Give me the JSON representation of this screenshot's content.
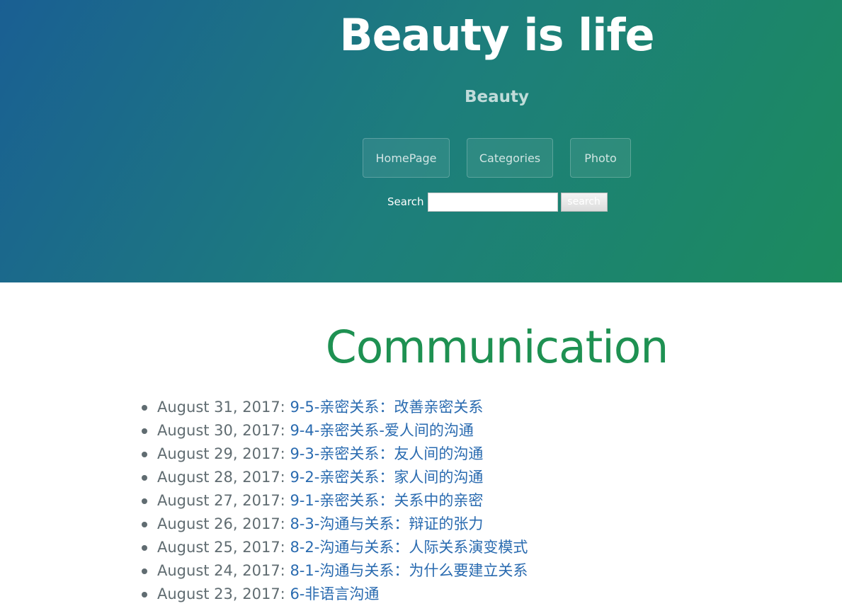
{
  "header": {
    "title": "Beauty is life",
    "tagline": "Beauty",
    "nav": [
      {
        "label": "HomePage"
      },
      {
        "label": "Categories"
      },
      {
        "label": "Photo"
      }
    ],
    "search": {
      "label": "Search",
      "value": "",
      "button_label": "search"
    }
  },
  "main": {
    "title": "Communication",
    "posts": [
      {
        "date": "August 31, 2017:",
        "title": "9-5-亲密关系：改善亲密关系"
      },
      {
        "date": "August 30, 2017:",
        "title": "9-4-亲密关系-爱人间的沟通"
      },
      {
        "date": "August 29, 2017:",
        "title": "9-3-亲密关系：友人间的沟通"
      },
      {
        "date": "August 28, 2017:",
        "title": "9-2-亲密关系：家人间的沟通"
      },
      {
        "date": "August 27, 2017:",
        "title": "9-1-亲密关系：关系中的亲密"
      },
      {
        "date": "August 26, 2017:",
        "title": "8-3-沟通与关系：辩证的张力"
      },
      {
        "date": "August 25, 2017:",
        "title": "8-2-沟通与关系：人际关系演变模式"
      },
      {
        "date": "August 24, 2017:",
        "title": "8-1-沟通与关系：为什么要建立关系"
      },
      {
        "date": "August 23, 2017:",
        "title": "6-非语言沟通"
      }
    ]
  },
  "colors": {
    "header_gradient_start": "#1a5f93",
    "header_gradient_end": "#1c8b5e",
    "page_title": "#1e9152",
    "link": "#2a6bb0",
    "text": "#606c71"
  }
}
